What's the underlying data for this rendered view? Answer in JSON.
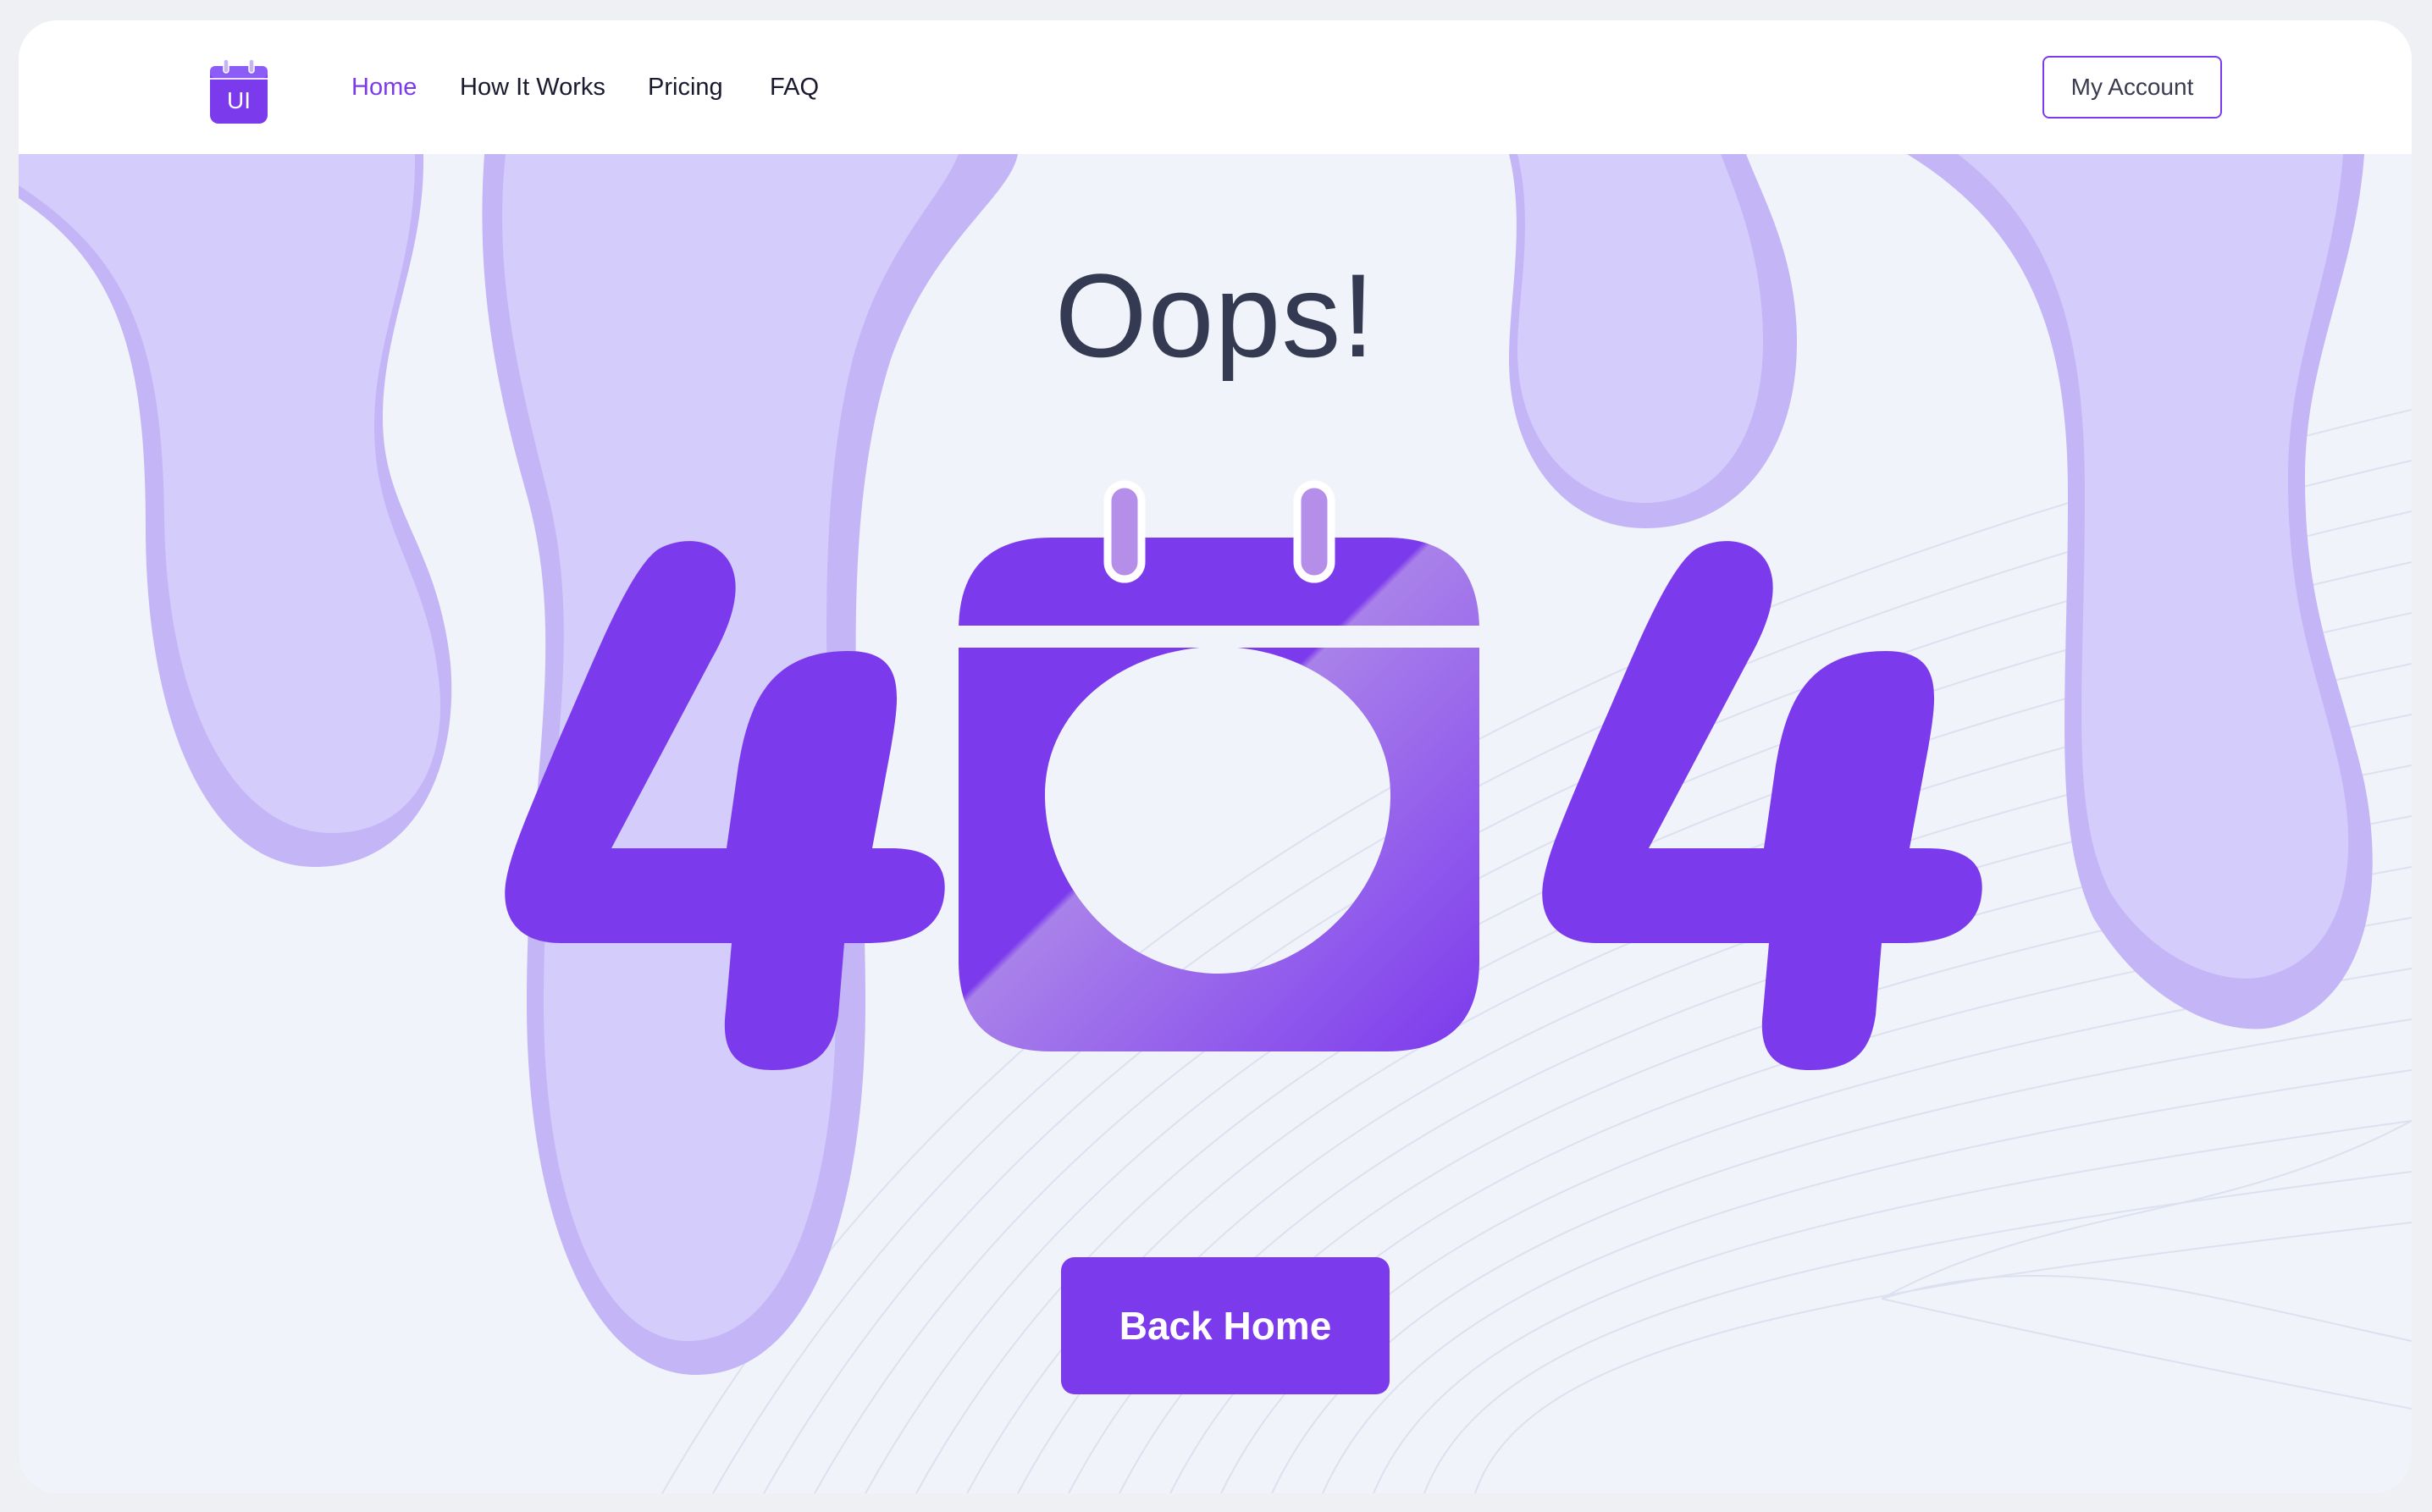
{
  "nav": {
    "logo_text": "UI",
    "items": [
      {
        "label": "Home",
        "active": true
      },
      {
        "label": "How It Works",
        "active": false
      },
      {
        "label": "Pricing",
        "active": false
      },
      {
        "label": "FAQ",
        "active": false
      }
    ],
    "account_button": "My Account"
  },
  "error": {
    "heading": "Oops!",
    "code": "404",
    "icon": "calendar-icon",
    "button": "Back Home"
  },
  "colors": {
    "accent": "#7c3aed",
    "drip_light": "#d4ccfa",
    "drip_dark": "#c4b5f7",
    "background": "#f0f3fa",
    "heading": "#343a52"
  }
}
